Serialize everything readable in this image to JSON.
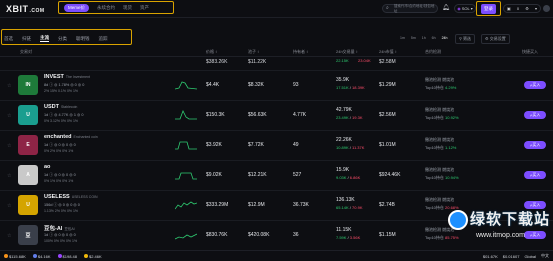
{
  "header": {
    "logo": "XBIT",
    "logo_domain": ".COM",
    "nav": [
      "Meme价",
      "永续合约",
      "现货",
      "资产"
    ],
    "search_placeholder": "搜索代币/合约地址/钱包地址",
    "chain": "SOL",
    "signup": "登录",
    "wallet_value": "0"
  },
  "tabs": [
    "首选",
    "扫链",
    "主流",
    "分类",
    "聪明钱",
    "追踪"
  ],
  "active_tab": "主流",
  "time_ranges": [
    "1m",
    "5m",
    "1h",
    "6h",
    "24h"
  ],
  "active_range": "24h",
  "filters": [
    "筛选",
    "交易设置"
  ],
  "columns": {
    "pair": "交易对",
    "price": "价格 ↕",
    "liquidity": "池子 ↕",
    "holders": "持有者 ↕",
    "volume": "24h交易量 ↕",
    "mcap": "24h市值 ↕",
    "checks": "合约检测",
    "quick": "快捷买入"
  },
  "rows": [
    {
      "name": "INVEST",
      "fullname": "The Investment",
      "meta": "8d  ⓘ  ◎ 1.78%  ◎ 0  ◎ 0",
      "stats": "  2%  15%  0.1%  0%  1%",
      "price": "$4.4K",
      "liq": "$8.32K",
      "holders": "93",
      "vol": "35.9K",
      "buys": "17.51K",
      "sells": "18.39K",
      "mcap": "$1.29M",
      "chk1": "撤池检测   燃烧池",
      "chk2": "Top10持仓 ",
      "pct": "4.29%",
      "pct_color": "g",
      "color": "#1e7a3a",
      "ab": "IN",
      "buy": "买入"
    },
    {
      "name": "USDT",
      "fullname": "Stablecoin",
      "meta": "1d  ⓘ  ◎ 4.77K  ◎ 1  ◎ 0",
      "stats": "  0%  3.12%  0%  0%  1%",
      "price": "$150.3K",
      "liq": "$56.63K",
      "holders": "4.77K",
      "vol": "42.79K",
      "buys": "23.49K",
      "sells": "19.3K",
      "mcap": "$2.56M",
      "chk1": "撤池检测   燃烧池",
      "chk2": "Top10持仓 ",
      "pct": "10.92%",
      "pct_color": "g",
      "color": "#1a9e8f",
      "ab": "U",
      "buy": "买入"
    },
    {
      "name": "enchanted",
      "fullname": "Enchanted coin",
      "meta": "1d  ⓘ  ◎ 0  ◎ 0  ◎ 0",
      "stats": "  0%  2%  0%  0%  1%",
      "price": "$3.92K",
      "liq": "$7.72K",
      "holders": "49",
      "vol": "22.26K",
      "buys": "10.89K",
      "sells": "11.37K",
      "mcap": "$1.01M",
      "chk1": "撤池检测   燃烧池",
      "chk2": "Top10持仓 ",
      "pct": "1.12%",
      "pct_color": "g",
      "color": "#8e2446",
      "ab": "E",
      "buy": "买入"
    },
    {
      "name": "ao",
      "fullname": "",
      "meta": "1d  ⓘ  ◎ 0  ◎ 0  ◎ 0",
      "stats": "  0%  1%  0%  0%  1%",
      "price": "$9.02K",
      "liq": "$12.21K",
      "holders": "527",
      "vol": "15.9K",
      "buys": "9.03K",
      "sells": "6.86K",
      "mcap": "$924.46K",
      "chk1": "撤池检测   燃烧池",
      "chk2": "Top10持仓 ",
      "pct": "10.94%",
      "pct_color": "g",
      "color": "#c9c9c9",
      "ab": "A",
      "buy": "买入"
    },
    {
      "name": "USELESS",
      "fullname": "USELESS COIN",
      "meta": "156d  ⓘ  ◎ 0  ◎ 0  ◎ 0",
      "stats": "  1.13%  2%  0%  0%  1%",
      "price": "$333.29M",
      "liq": "$12.9M",
      "holders": "36.73K",
      "vol": "136.13K",
      "buys": "65.14K",
      "sells": "70.9K",
      "mcap": "$2.74B",
      "chk1": "撤池检测   燃烧池",
      "chk2": "Top10持仓 ",
      "pct": "20.68%",
      "pct_color": "r",
      "color": "#d4a400",
      "ab": "U",
      "buy": "买入"
    },
    {
      "name": "豆包-AI",
      "fullname": "豆包AI",
      "meta": "1d  ⓘ  ◎ 0  ◎ 0  ◎ 0",
      "stats": "  100%  0%  0%  0%  1%",
      "price": "$830.76K",
      "liq": "$420.08K",
      "holders": "36",
      "vol": "11.15K",
      "buys": "7.59K",
      "sells": "3.56K",
      "mcap": "$1.15M",
      "chk1": "撤池检测   燃烧池",
      "chk2": "Top10持仓 ",
      "pct": "85.75%",
      "pct_color": "r",
      "color": "#3a3f4a",
      "ab": "豆",
      "buy": "买入"
    }
  ],
  "top_partial": {
    "price": "$383.26K",
    "liq": "$11.22K",
    "vol": "22.15K",
    "buys": "23.04K",
    "mcap": "$2.58M"
  },
  "bottombar": {
    "items": [
      "$115.68K",
      "$4.16K",
      "$198.48",
      "$2.46K"
    ],
    "right": [
      "$01.67K",
      "$0.01607",
      "Global",
      "中文"
    ]
  },
  "watermark": {
    "title": "绿软下载站",
    "url": "www.itmop.com"
  },
  "colors": {
    "accent": "#7c4dff",
    "frame": "#d9a300",
    "up": "#2ecc71",
    "down": "#ff4d6a"
  }
}
